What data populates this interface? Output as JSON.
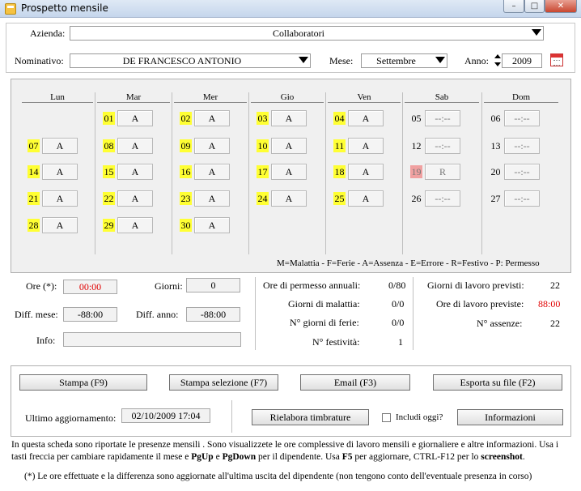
{
  "window": {
    "title": "Prospetto mensile",
    "minimize": "–",
    "maximize": "□",
    "close": "✕"
  },
  "header": {
    "azienda_label": "Azienda:",
    "azienda_value": "Collaboratori",
    "nominativo_label": "Nominativo:",
    "nominativo_value": "DE FRANCESCO ANTONIO",
    "mese_label": "Mese:",
    "mese_value": "Settembre",
    "anno_label": "Anno:",
    "anno_value": "2009"
  },
  "calendar": {
    "days": [
      "Lun",
      "Mar",
      "Mer",
      "Gio",
      "Ven",
      "Sab",
      "Dom"
    ],
    "cells": [
      {
        "col": 1,
        "row": 0,
        "num": "01",
        "val": "A",
        "style": "yellow"
      },
      {
        "col": 2,
        "row": 0,
        "num": "02",
        "val": "A",
        "style": "yellow"
      },
      {
        "col": 3,
        "row": 0,
        "num": "03",
        "val": "A",
        "style": "yellow"
      },
      {
        "col": 4,
        "row": 0,
        "num": "04",
        "val": "A",
        "style": "yellow"
      },
      {
        "col": 5,
        "row": 0,
        "num": "05",
        "val": "--:--",
        "style": "plain"
      },
      {
        "col": 6,
        "row": 0,
        "num": "06",
        "val": "--:--",
        "style": "plain"
      },
      {
        "col": 0,
        "row": 1,
        "num": "07",
        "val": "A",
        "style": "yellow"
      },
      {
        "col": 1,
        "row": 1,
        "num": "08",
        "val": "A",
        "style": "yellow"
      },
      {
        "col": 2,
        "row": 1,
        "num": "09",
        "val": "A",
        "style": "yellow"
      },
      {
        "col": 3,
        "row": 1,
        "num": "10",
        "val": "A",
        "style": "yellow"
      },
      {
        "col": 4,
        "row": 1,
        "num": "11",
        "val": "A",
        "style": "yellow"
      },
      {
        "col": 5,
        "row": 1,
        "num": "12",
        "val": "--:--",
        "style": "plain"
      },
      {
        "col": 6,
        "row": 1,
        "num": "13",
        "val": "--:--",
        "style": "plain"
      },
      {
        "col": 0,
        "row": 2,
        "num": "14",
        "val": "A",
        "style": "yellow"
      },
      {
        "col": 1,
        "row": 2,
        "num": "15",
        "val": "A",
        "style": "yellow"
      },
      {
        "col": 2,
        "row": 2,
        "num": "16",
        "val": "A",
        "style": "yellow"
      },
      {
        "col": 3,
        "row": 2,
        "num": "17",
        "val": "A",
        "style": "yellow"
      },
      {
        "col": 4,
        "row": 2,
        "num": "18",
        "val": "A",
        "style": "yellow"
      },
      {
        "col": 5,
        "row": 2,
        "num": "19",
        "val": "R",
        "style": "red"
      },
      {
        "col": 6,
        "row": 2,
        "num": "20",
        "val": "--:--",
        "style": "plain"
      },
      {
        "col": 0,
        "row": 3,
        "num": "21",
        "val": "A",
        "style": "yellow"
      },
      {
        "col": 1,
        "row": 3,
        "num": "22",
        "val": "A",
        "style": "yellow"
      },
      {
        "col": 2,
        "row": 3,
        "num": "23",
        "val": "A",
        "style": "yellow"
      },
      {
        "col": 3,
        "row": 3,
        "num": "24",
        "val": "A",
        "style": "yellow"
      },
      {
        "col": 4,
        "row": 3,
        "num": "25",
        "val": "A",
        "style": "yellow"
      },
      {
        "col": 5,
        "row": 3,
        "num": "26",
        "val": "--:--",
        "style": "plain"
      },
      {
        "col": 6,
        "row": 3,
        "num": "27",
        "val": "--:--",
        "style": "plain"
      },
      {
        "col": 0,
        "row": 4,
        "num": "28",
        "val": "A",
        "style": "yellow"
      },
      {
        "col": 1,
        "row": 4,
        "num": "29",
        "val": "A",
        "style": "yellow"
      },
      {
        "col": 2,
        "row": 4,
        "num": "30",
        "val": "A",
        "style": "yellow"
      }
    ],
    "legend": "M=Malattia  - F=Ferie  - A=Assenza - E=Errore - R=Festivo - P: Permesso"
  },
  "summary": {
    "ore_label": "Ore (*):",
    "ore_value": "00:00",
    "giorni_label": "Giorni:",
    "giorni_value": "0",
    "diff_mese_label": "Diff. mese:",
    "diff_mese_value": "-88:00",
    "diff_anno_label": "Diff. anno:",
    "diff_anno_value": "-88:00",
    "info_label": "Info:",
    "info_value": "",
    "permesso_label": "Ore di permesso annuali:",
    "permesso_value": "0/80",
    "malattia_label": "Giorni di malattia:",
    "malattia_value": "0/0",
    "ferie_label": "N° giorni di ferie:",
    "ferie_value": "0/0",
    "festivita_label": "N° festività:",
    "festivita_value": "1",
    "lavoro_previsti_label": "Giorni di lavoro previsti:",
    "lavoro_previsti_value": "22",
    "ore_previste_label": "Ore di lavoro previste:",
    "ore_previste_value": "88:00",
    "assenze_label": "N° assenze:",
    "assenze_value": "22"
  },
  "actions": {
    "stampa": "Stampa  (F9)",
    "stampa_selezione": "Stampa selezione (F7)",
    "email": "Email  (F3)",
    "esporta": "Esporta su file (F2)",
    "ultimo_label": "Ultimo aggiornamento:",
    "ultimo_value": "02/10/2009 17:04",
    "rielabora": "Rielabora timbrature",
    "includi": "Includi oggi?",
    "informazioni": "Informazioni"
  },
  "footer": {
    "p1": "In questa scheda sono riportate le presenze mensili . Sono visualizzete le ore complessive di lavoro mensili e giornaliere e altre informazioni. Usa i tasti freccia per cambiare rapidamente il mese e ",
    "pgup": "PgUp",
    "and": " e ",
    "pgdown": "PgDown",
    "p2": " per il dipendente. Usa ",
    "f5": "F5",
    "p3": " per aggiornare, CTRL-F12 per lo ",
    "screenshot": "screenshot",
    "p4": ".",
    "note": "(*) Le ore effettuate e la differenza sono aggiornate all'ultima uscita del dipendente (non tengono conto dell'eventuale presenza in corso)"
  },
  "colors": {
    "highlight": "#ffff33",
    "festivo": "#f0a0a0",
    "alert": "#e00000"
  }
}
